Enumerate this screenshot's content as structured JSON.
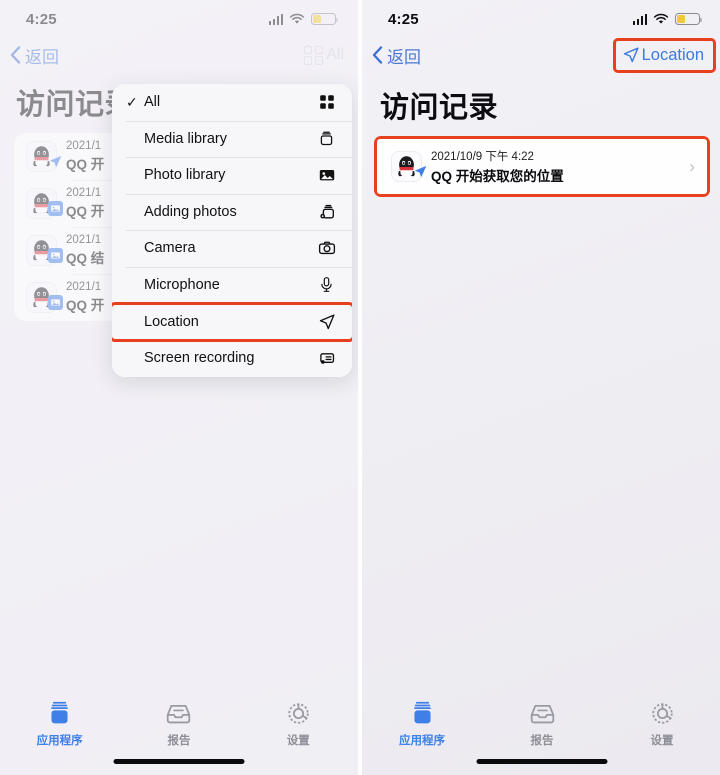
{
  "status_bar": {
    "time": "4:25",
    "signal_icon": "cellular-signal-icon",
    "wifi_icon": "wifi-icon",
    "battery_icon": "battery-low-power-icon",
    "battery_percent": 38
  },
  "left_panel": {
    "nav": {
      "back_label": "返回",
      "back_icon": "chevron-left-icon",
      "filter_label": "All",
      "filter_icon": "grid-icon"
    },
    "page_title": "访问记录",
    "records": [
      {
        "date": "2021/1",
        "desc": "QQ 开",
        "app_icon": "qq-app-icon",
        "badge": "location-arrow-badge"
      },
      {
        "date": "2021/1",
        "desc": "QQ 开",
        "app_icon": "qq-app-icon",
        "badge": "photo-library-badge"
      },
      {
        "date": "2021/1",
        "desc": "QQ 结",
        "app_icon": "qq-app-icon",
        "badge": "photo-library-badge"
      },
      {
        "date": "2021/1",
        "desc": "QQ 开",
        "app_icon": "qq-app-icon",
        "badge": "photo-library-badge"
      }
    ],
    "dropdown": {
      "items": [
        {
          "label": "All",
          "icon": "grid-icon",
          "checked": true,
          "highlighted": false
        },
        {
          "label": "Media library",
          "icon": "media-library-icon",
          "checked": false,
          "highlighted": false
        },
        {
          "label": "Photo library",
          "icon": "photo-library-icon",
          "checked": false,
          "highlighted": false
        },
        {
          "label": "Adding photos",
          "icon": "adding-photos-icon",
          "checked": false,
          "highlighted": false
        },
        {
          "label": "Camera",
          "icon": "camera-icon",
          "checked": false,
          "highlighted": false
        },
        {
          "label": "Microphone",
          "icon": "microphone-icon",
          "checked": false,
          "highlighted": false
        },
        {
          "label": "Location",
          "icon": "location-arrow-icon",
          "checked": false,
          "highlighted": true
        },
        {
          "label": "Screen recording",
          "icon": "screen-recording-icon",
          "checked": false,
          "highlighted": false
        }
      ],
      "check_glyph": "✓"
    }
  },
  "right_panel": {
    "nav": {
      "back_label": "返回",
      "back_icon": "chevron-left-icon",
      "filter_label": "Location",
      "filter_icon": "location-arrow-icon"
    },
    "page_title": "访问记录",
    "records": [
      {
        "date": "2021/10/9 下午 4:22",
        "desc": "QQ 开始获取您的位置",
        "app_icon": "qq-app-icon",
        "badge": "location-arrow-badge",
        "chevron": "›"
      }
    ]
  },
  "tab_bar": {
    "tabs": [
      {
        "label": "应用程序",
        "icon": "apps-jar-icon",
        "active": true
      },
      {
        "label": "报告",
        "icon": "reports-tray-icon",
        "active": false
      },
      {
        "label": "设置",
        "icon": "settings-gear-icon",
        "active": false
      }
    ]
  },
  "colors": {
    "accent_blue": "#3f7fe8",
    "highlight_red": "#e8401f",
    "background": "#f0eff4",
    "card": "#fefefe",
    "battery_yellow": "#f2c938"
  }
}
